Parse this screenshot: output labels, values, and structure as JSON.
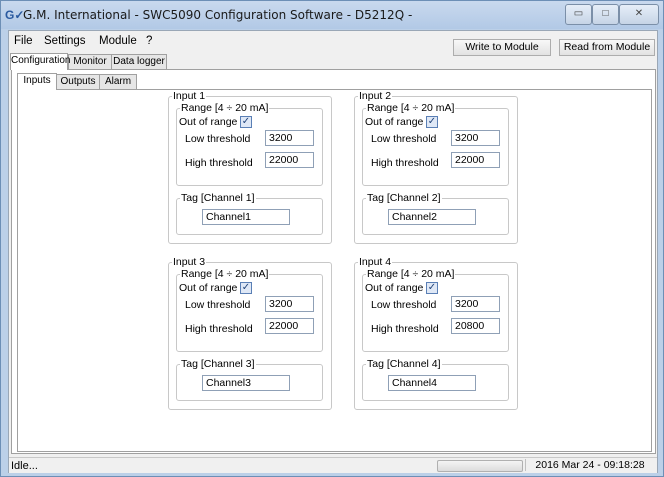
{
  "window": {
    "title": "G.M. International - SWC5090 Configuration Software - D5212Q -"
  },
  "window_controls": {
    "minimize": "▭",
    "maximize": "□",
    "close": "✕"
  },
  "menu": {
    "items": [
      "File",
      "Settings",
      "Module",
      "?"
    ]
  },
  "toolbar": {
    "write": "Write to Module",
    "read": "Read from Module"
  },
  "tabs": [
    "Configuration",
    "Monitor",
    "Data logger"
  ],
  "subtabs": [
    "Inputs",
    "Outputs",
    "Alarm"
  ],
  "common": {
    "range_label": "Range [4 ÷ 20 mA]",
    "out_of_range": "Out of range",
    "low_threshold": "Low threshold",
    "high_threshold": "High threshold",
    "check_mark": "✓"
  },
  "inputs": [
    {
      "title": "Input 1",
      "low": "3200",
      "high": "22000",
      "tag_label": "Tag [Channel 1]",
      "tag": "Channel1",
      "out_of_range": true
    },
    {
      "title": "Input 2",
      "low": "3200",
      "high": "22000",
      "tag_label": "Tag [Channel 2]",
      "tag": "Channel2",
      "out_of_range": true
    },
    {
      "title": "Input 3",
      "low": "3200",
      "high": "22000",
      "tag_label": "Tag [Channel 3]",
      "tag": "Channel3",
      "out_of_range": true
    },
    {
      "title": "Input 4",
      "low": "3200",
      "high": "20800",
      "tag_label": "Tag [Channel 4]",
      "tag": "Channel4",
      "out_of_range": true
    }
  ],
  "status": {
    "text": "Idle...",
    "datetime": "2016 Mar 24 - 09:18:28"
  }
}
